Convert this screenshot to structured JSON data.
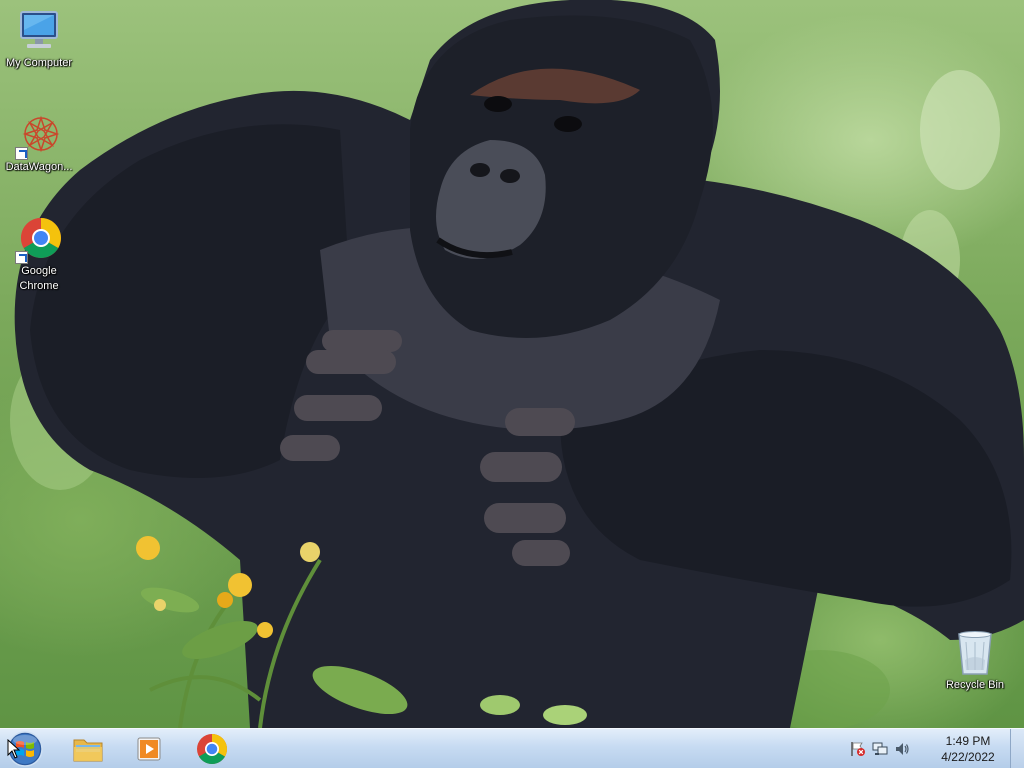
{
  "desktop": {
    "icons": [
      {
        "label": "My Computer",
        "icon": "computer-icon"
      },
      {
        "label": "DataWagon...",
        "icon": "datawagon-icon",
        "shortcut": true
      },
      {
        "label": "Google",
        "label2": "Chrome",
        "icon": "chrome-icon",
        "shortcut": true
      },
      {
        "label": "Recycle Bin",
        "icon": "recycle-bin-icon"
      }
    ],
    "wallpaper": "gorilla-wallpaper"
  },
  "taskbar": {
    "start": "windows-start-orb-icon",
    "pinned": [
      {
        "icon": "file-explorer-icon"
      },
      {
        "icon": "media-player-icon"
      },
      {
        "icon": "chrome-icon"
      }
    ],
    "tray": {
      "icons": [
        "action-center-flag-icon",
        "network-icon",
        "volume-icon"
      ],
      "time": "1:49 PM",
      "date": "4/22/2022"
    }
  },
  "colors": {
    "taskbar_top": "#e3eefa",
    "taskbar_bottom": "#b4cde9",
    "chrome_red": "#db4437",
    "chrome_yellow": "#f4c20d",
    "chrome_green": "#0f9d58",
    "chrome_blue": "#4285f4"
  }
}
